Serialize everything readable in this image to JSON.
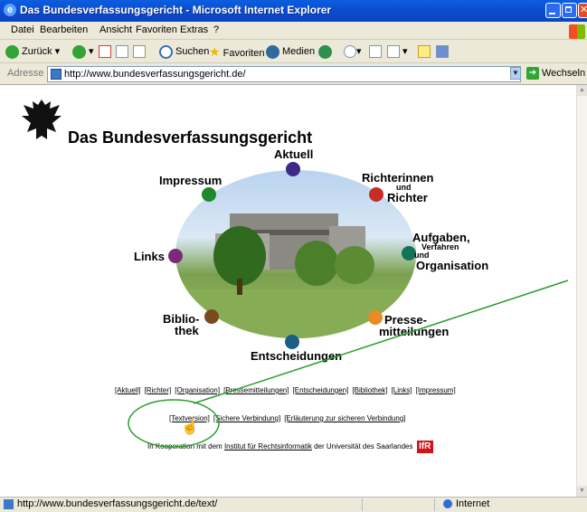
{
  "window": {
    "title": "Das Bundesverfassungsgericht - Microsoft Internet Explorer"
  },
  "menu": [
    "Datei",
    "Bearbeiten",
    "Ansicht",
    "Favoriten",
    "Extras",
    "?"
  ],
  "toolbar": {
    "back": "Zurück",
    "search": "Suchen",
    "favorites": "Favoriten",
    "media": "Medien"
  },
  "address": {
    "label": "Adresse",
    "url": "http://www.bundesverfassungsgericht.de/",
    "go": "Wechseln zu"
  },
  "site": {
    "title": "Das Bundesverfassungsgericht",
    "nav": {
      "aktuell": "Aktuell",
      "impressum": "Impressum",
      "richter1": "Richterinnen",
      "richter_und": "und",
      "richter2": "Richter",
      "aufgaben1": "Aufgaben,",
      "aufgaben2": "Verfahren",
      "aufgaben_und": "und",
      "aufgaben3": "Organisation",
      "links": "Links",
      "bibliothek1": "Biblio-",
      "bibliothek2": "thek",
      "presse1": "Presse-",
      "presse2": "mitteilungen",
      "entscheidungen": "Entscheidungen"
    },
    "textlinks": [
      "[Aktuell]",
      "[Richter]",
      "[Organisation]",
      "[Pressemitteilungen]",
      "[Entscheidungen]",
      "[Bibliothek]",
      "[Links]",
      "[Impressum]"
    ],
    "extra_links": [
      "[Textversion]",
      "[Sichere Verbindung]",
      "[Erläuterung zur sicheren Verbindung]"
    ],
    "coop": {
      "prefix": "In Kooperation mit dem",
      "link": "Institut für Rechtsinformatik",
      "suffix": "der Universität des Saarlandes",
      "logo": "IfR"
    }
  },
  "status": {
    "url": "http://www.bundesverfassungsgericht.de/text/",
    "zone": "Internet"
  },
  "colors": {
    "aktuell": "#3e2a86",
    "impressum": "#1f8a2c",
    "richter": "#c62d26",
    "aufgaben": "#127357",
    "links": "#7b2a7a",
    "bibliothek": "#7a4a1e",
    "presse": "#e88d25",
    "entscheidungen": "#1b5e86",
    "annotation": "#2a9d2a"
  }
}
